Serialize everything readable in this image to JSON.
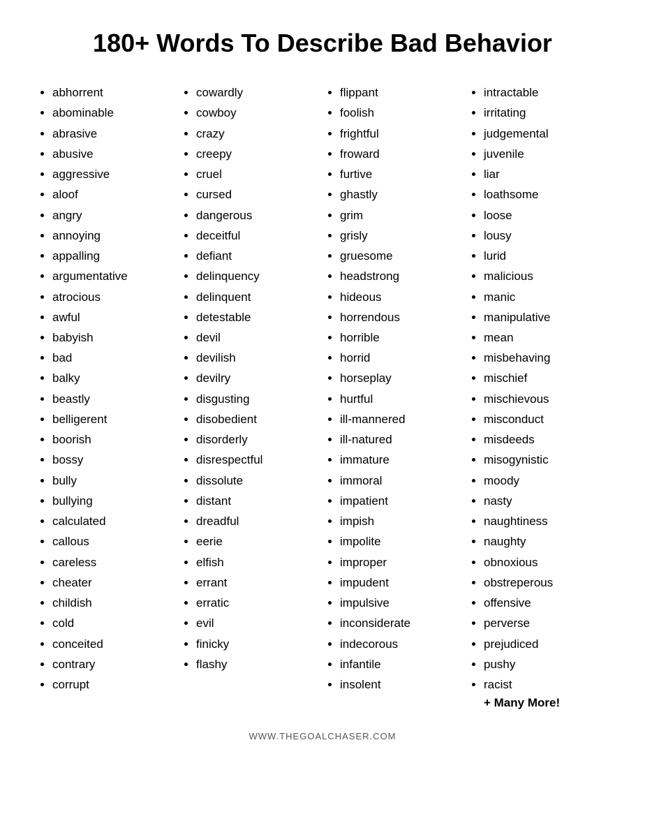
{
  "title": "180+ Words To Describe Bad Behavior",
  "columns": [
    {
      "id": "col1",
      "words": [
        "abhorrent",
        "abominable",
        "abrasive",
        "abusive",
        "aggressive",
        "aloof",
        "angry",
        "annoying",
        "appalling",
        "argumentative",
        "atrocious",
        "awful",
        "babyish",
        "bad",
        "balky",
        "beastly",
        "belligerent",
        "boorish",
        "bossy",
        "bully",
        "bullying",
        "calculated",
        "callous",
        "careless",
        "cheater",
        "childish",
        "cold",
        "conceited",
        "contrary",
        "corrupt"
      ]
    },
    {
      "id": "col2",
      "words": [
        "cowardly",
        "cowboy",
        "crazy",
        "creepy",
        "cruel",
        "cursed",
        "dangerous",
        "deceitful",
        "defiant",
        "delinquency",
        "delinquent",
        "detestable",
        "devil",
        "devilish",
        "devilry",
        "disgusting",
        "disobedient",
        "disorderly",
        "disrespectful",
        "dissolute",
        "distant",
        "dreadful",
        "eerie",
        "elfish",
        "errant",
        "erratic",
        "evil",
        "finicky",
        "flashy"
      ]
    },
    {
      "id": "col3",
      "words": [
        "flippant",
        "foolish",
        "frightful",
        "froward",
        "furtive",
        "ghastly",
        "grim",
        "grisly",
        "gruesome",
        "headstrong",
        "hideous",
        "horrendous",
        "horrible",
        "horrid",
        "horseplay",
        "hurtful",
        "ill-mannered",
        "ill-natured",
        "immature",
        "immoral",
        "impatient",
        "impish",
        "impolite",
        "improper",
        "impudent",
        "impulsive",
        "inconsiderate",
        "indecorous",
        "infantile",
        "insolent"
      ]
    },
    {
      "id": "col4",
      "words": [
        "intractable",
        "irritating",
        "judgemental",
        "juvenile",
        "liar",
        "loathsome",
        "loose",
        "lousy",
        "lurid",
        "malicious",
        "manic",
        "manipulative",
        "mean",
        "misbehaving",
        "mischief",
        "mischievous",
        "misconduct",
        "misdeeds",
        "misogynistic",
        "moody",
        "nasty",
        "naughtiness",
        "naughty",
        "obnoxious",
        "obstreperous",
        "offensive",
        "perverse",
        "prejudiced",
        "pushy",
        "racist"
      ],
      "suffix": "+ Many More!"
    }
  ],
  "footer": "WWW.THEGOALCHASER.COM"
}
